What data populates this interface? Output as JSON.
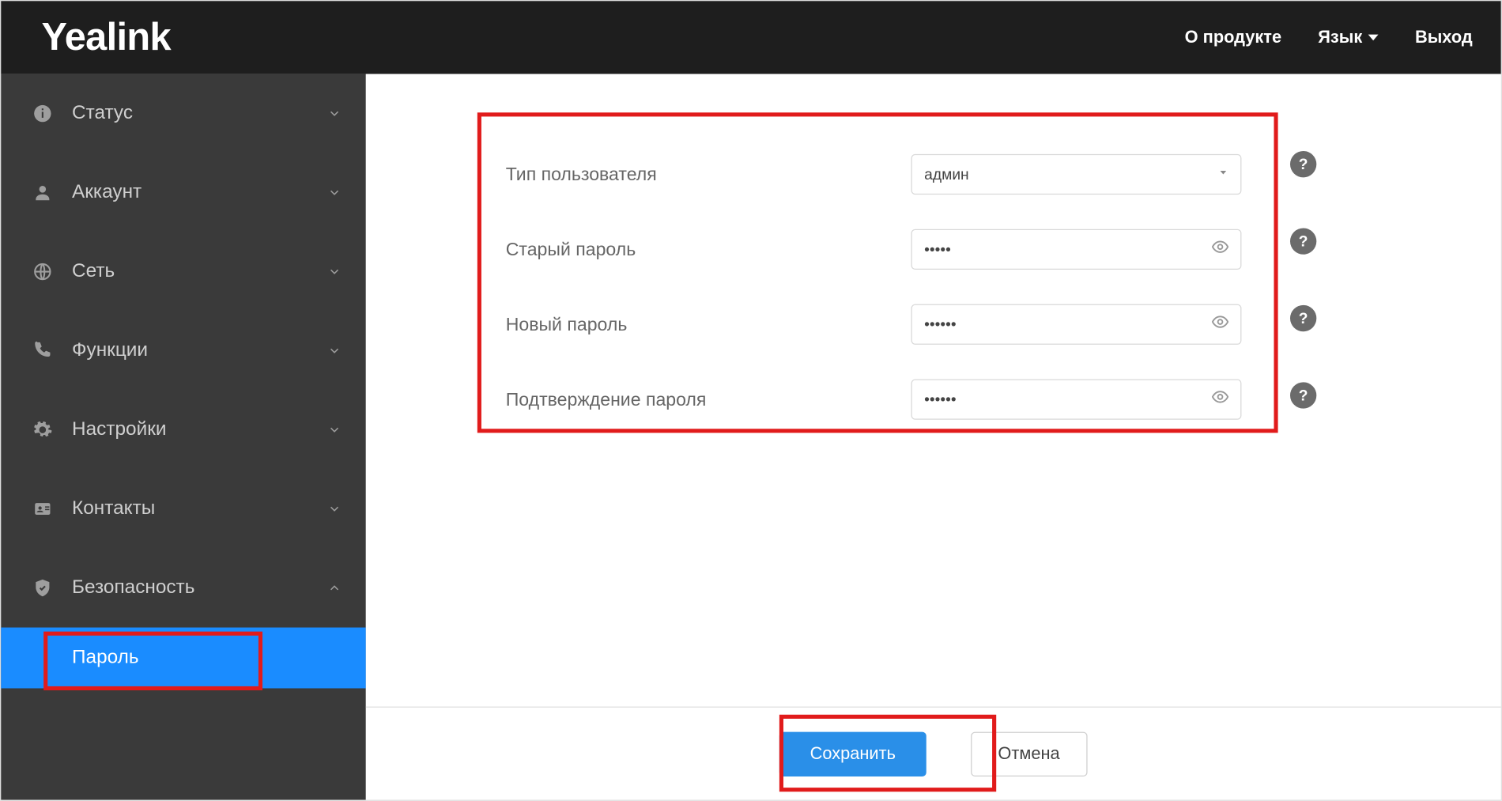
{
  "header": {
    "logo": "Yealink",
    "about": "О продукте",
    "language": "Язык",
    "logout": "Выход"
  },
  "sidebar": {
    "items": [
      {
        "label": "Статус",
        "expanded": false
      },
      {
        "label": "Аккаунт",
        "expanded": false
      },
      {
        "label": "Сеть",
        "expanded": false
      },
      {
        "label": "Функции",
        "expanded": false
      },
      {
        "label": "Настройки",
        "expanded": false
      },
      {
        "label": "Контакты",
        "expanded": false
      },
      {
        "label": "Безопасность",
        "expanded": true
      }
    ],
    "sub_password": "Пароль"
  },
  "form": {
    "user_type_label": "Тип пользователя",
    "user_type_value": "админ",
    "old_pw_label": "Старый пароль",
    "old_pw_value": "•••••",
    "new_pw_label": "Новый пароль",
    "new_pw_value": "••••••",
    "confirm_pw_label": "Подтверждение пароля",
    "confirm_pw_value": "••••••"
  },
  "help_glyph": "?",
  "buttons": {
    "save": "Сохранить",
    "cancel": "Отмена"
  }
}
